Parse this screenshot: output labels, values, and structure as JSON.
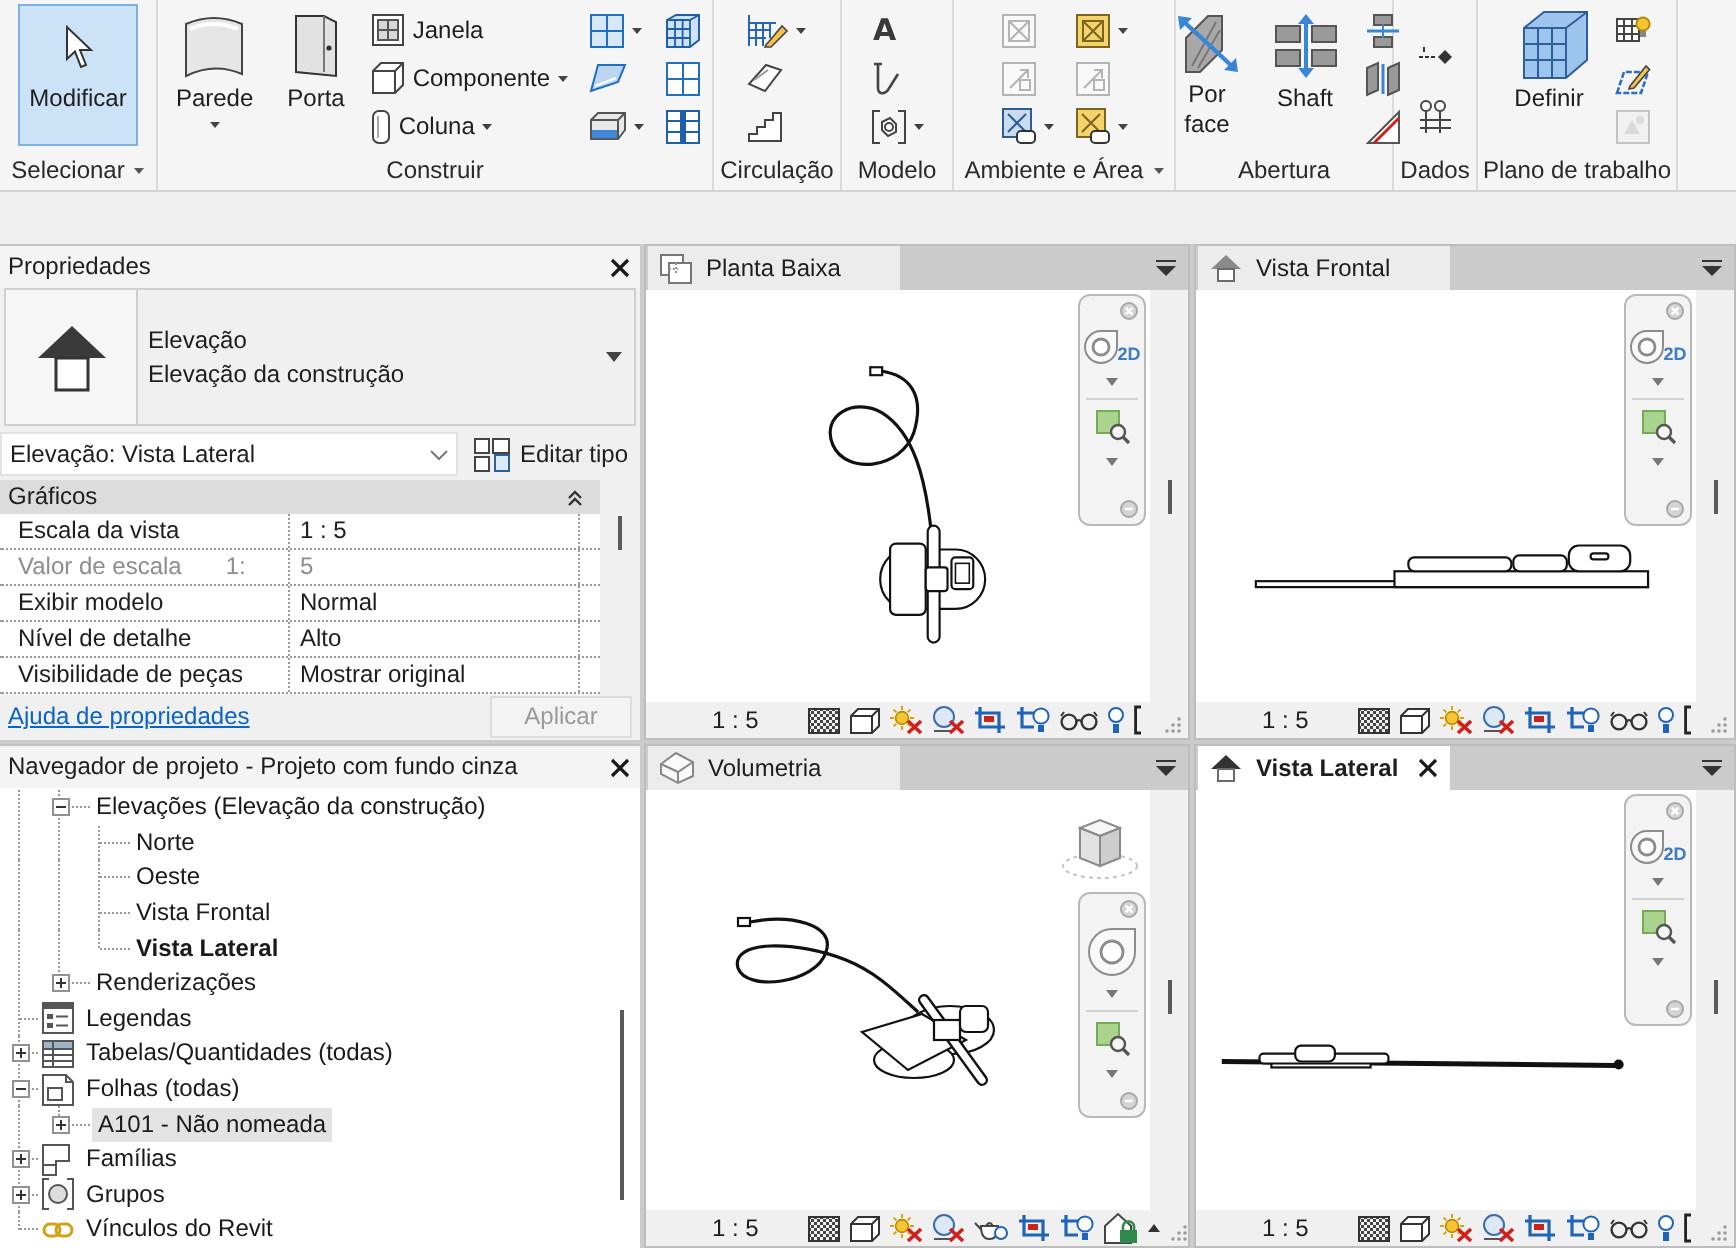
{
  "ribbon": {
    "panels": [
      {
        "label": "Selecionar",
        "menu": true,
        "columns": [
          [
            {
              "kind": "large",
              "label": "Modificar",
              "selected": true,
              "disabled": false,
              "dropdown": false
            }
          ]
        ]
      },
      {
        "label": "Construir",
        "menu": false,
        "columns": [
          [
            {
              "kind": "large",
              "label": "Parede",
              "selected": false,
              "disabled": false,
              "dropdown": true
            }
          ],
          [
            {
              "kind": "large",
              "label": "Porta",
              "selected": false,
              "disabled": false,
              "dropdown": false
            }
          ],
          [
            {
              "kind": "small",
              "label": "Janela",
              "selected": false,
              "disabled": false,
              "dropdown": false
            },
            {
              "kind": "small",
              "label": "Componente",
              "selected": false,
              "disabled": false,
              "dropdown": true
            },
            {
              "kind": "small",
              "label": "Coluna",
              "selected": false,
              "disabled": false,
              "dropdown": true
            }
          ],
          [
            {
              "kind": "icon",
              "selected": false,
              "disabled": false,
              "dropdown": true
            },
            {
              "kind": "icon",
              "selected": false,
              "disabled": false,
              "dropdown": false
            },
            {
              "kind": "icon",
              "selected": false,
              "disabled": false,
              "dropdown": true
            }
          ],
          [
            {
              "kind": "icon",
              "selected": false,
              "disabled": false,
              "dropdown": false
            },
            {
              "kind": "icon",
              "selected": false,
              "disabled": false,
              "dropdown": false
            },
            {
              "kind": "icon",
              "selected": false,
              "disabled": false,
              "dropdown": false
            }
          ]
        ]
      },
      {
        "label": "Circulação",
        "menu": false,
        "columns": [
          [
            {
              "kind": "icon",
              "selected": false,
              "disabled": false,
              "dropdown": true
            },
            {
              "kind": "icon",
              "selected": false,
              "disabled": false,
              "dropdown": false
            },
            {
              "kind": "icon",
              "selected": false,
              "disabled": false,
              "dropdown": false
            }
          ]
        ]
      },
      {
        "label": "Modelo",
        "menu": false,
        "columns": [
          [
            {
              "kind": "glyph",
              "glyph": "A",
              "selected": false,
              "disabled": false,
              "dropdown": false
            },
            {
              "kind": "icon",
              "selected": false,
              "disabled": false,
              "dropdown": false
            },
            {
              "kind": "icon",
              "selected": false,
              "disabled": false,
              "dropdown": true
            }
          ]
        ]
      },
      {
        "label": "Ambiente e Área",
        "menu": true,
        "columns": [
          [
            {
              "kind": "icon",
              "selected": false,
              "disabled": true,
              "dropdown": false
            },
            {
              "kind": "icon",
              "selected": false,
              "disabled": true,
              "dropdown": false
            },
            {
              "kind": "icon",
              "selected": false,
              "disabled": false,
              "dropdown": true
            }
          ],
          [
            {
              "kind": "icon",
              "selected": false,
              "disabled": false,
              "dropdown": true
            },
            {
              "kind": "icon",
              "selected": false,
              "disabled": true,
              "dropdown": false
            },
            {
              "kind": "icon",
              "selected": false,
              "disabled": false,
              "dropdown": true
            }
          ]
        ]
      },
      {
        "label": "Abertura",
        "menu": false,
        "columns": [
          [
            {
              "kind": "large",
              "label": "Por face",
              "selected": false,
              "disabled": false,
              "dropdown": false
            }
          ],
          [
            {
              "kind": "large",
              "label": "Shaft",
              "selected": false,
              "disabled": false,
              "dropdown": false
            }
          ],
          [
            {
              "kind": "icon",
              "selected": false,
              "disabled": false,
              "dropdown": false
            },
            {
              "kind": "icon",
              "selected": false,
              "disabled": false,
              "dropdown": false
            },
            {
              "kind": "icon",
              "selected": false,
              "disabled": false,
              "dropdown": false
            }
          ]
        ]
      },
      {
        "label": "Dados",
        "menu": false,
        "columns": [
          [
            {
              "kind": "icon",
              "selected": false,
              "disabled": false,
              "dropdown": false
            },
            {
              "kind": "icon",
              "selected": false,
              "disabled": false,
              "dropdown": false
            }
          ]
        ]
      },
      {
        "label": "Plano de trabalho",
        "menu": false,
        "columns": [
          [
            {
              "kind": "large",
              "label": "Definir",
              "selected": false,
              "disabled": false,
              "dropdown": false
            }
          ],
          [
            {
              "kind": "icon",
              "selected": false,
              "disabled": false,
              "dropdown": false
            },
            {
              "kind": "icon",
              "selected": false,
              "disabled": false,
              "dropdown": false
            },
            {
              "kind": "icon",
              "selected": false,
              "disabled": true,
              "dropdown": false
            }
          ]
        ]
      }
    ]
  },
  "properties": {
    "title": "Propriedades",
    "type_name": "Elevação",
    "type_family": "Elevação da construção",
    "instance": "Elevação: Vista Lateral",
    "edit_type": "Editar tipo",
    "groups": [
      {
        "label": "Gráficos",
        "expanded": true,
        "rows": [
          {
            "name": "Escala da vista",
            "value": "1 : 5",
            "disabled": false
          },
          {
            "name": "Valor de escala",
            "unit": "1:",
            "value": "5",
            "disabled": true
          },
          {
            "name": "Exibir modelo",
            "value": "Normal",
            "disabled": false
          },
          {
            "name": "Nível de detalhe",
            "value": "Alto",
            "disabled": false
          },
          {
            "name": "Visibilidade de peças",
            "value": "Mostrar original",
            "disabled": false
          }
        ]
      }
    ],
    "help": "Ajuda de propriedades",
    "apply": {
      "label": "Aplicar",
      "disabled": true
    }
  },
  "browser": {
    "title": "Navegador de projeto - Projeto com fundo cinza",
    "items": [
      {
        "children": [
          {
            "label": "Elevações (Elevação da construção)",
            "expanded": true,
            "selected": false,
            "active": false,
            "children": [
              {
                "label": "Norte",
                "selected": false,
                "active": false
              },
              {
                "label": "Oeste",
                "selected": false,
                "active": false
              },
              {
                "label": "Vista Frontal",
                "selected": false,
                "active": false
              },
              {
                "label": "Vista Lateral",
                "selected": false,
                "active": true
              }
            ]
          },
          {
            "label": "Renderizações",
            "expanded": false,
            "selected": false,
            "active": false
          }
        ]
      },
      {
        "label": "Legendas",
        "selected": false,
        "active": false
      },
      {
        "label": "Tabelas/Quantidades (todas)",
        "expanded": false,
        "selected": false,
        "active": false
      },
      {
        "label": "Folhas (todas)",
        "expanded": true,
        "selected": false,
        "active": false,
        "children": [
          {
            "label": "A101 - Não nomeada",
            "expanded": false,
            "selected": true,
            "active": false
          }
        ]
      },
      {
        "label": "Famílias",
        "expanded": false,
        "selected": false,
        "active": false
      },
      {
        "label": "Grupos",
        "expanded": false,
        "selected": false,
        "active": false
      },
      {
        "label": "Vínculos do Revit",
        "selected": false,
        "active": false
      }
    ]
  },
  "views": [
    {
      "title": "Planta Baixa",
      "kind": "plan",
      "selected": false,
      "scale": "1 : 5",
      "wheel_label": "2D"
    },
    {
      "title": "Vista Frontal",
      "kind": "front",
      "selected": false,
      "scale": "1 : 5",
      "wheel_label": "2D"
    },
    {
      "title": "Volumetria",
      "kind": "perspective",
      "selected": false,
      "scale": "1 : 5"
    },
    {
      "title": "Vista Lateral",
      "kind": "side",
      "selected": true,
      "scale": "1 : 5",
      "wheel_label": "2D"
    }
  ]
}
